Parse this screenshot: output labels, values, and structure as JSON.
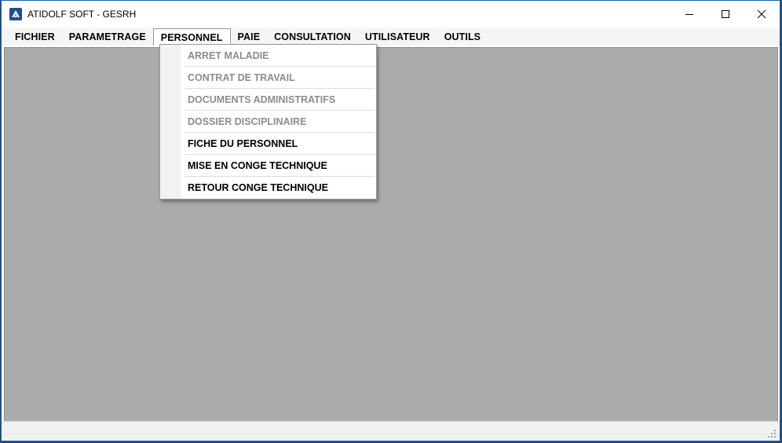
{
  "window": {
    "title": "ATIDOLF SOFT - GESRH",
    "controls": [
      "minimize-icon",
      "maximize-icon",
      "close-icon"
    ]
  },
  "menubar": {
    "items": [
      {
        "label": "FICHIER"
      },
      {
        "label": "PARAMETRAGE"
      },
      {
        "label": "PERSONNEL",
        "open": true
      },
      {
        "label": "PAIE"
      },
      {
        "label": "CONSULTATION"
      },
      {
        "label": "UTILISATEUR"
      },
      {
        "label": "OUTILS"
      }
    ]
  },
  "dropdown": {
    "items": [
      {
        "label": "ARRET MALADIE",
        "enabled": false
      },
      {
        "label": "CONTRAT DE TRAVAIL",
        "enabled": false
      },
      {
        "label": "DOCUMENTS ADMINISTRATIFS",
        "enabled": false
      },
      {
        "label": "DOSSIER DISCIPLINAIRE",
        "enabled": false
      },
      {
        "label": "FICHE DU PERSONNEL",
        "enabled": true
      },
      {
        "label": "MISE EN CONGE TECHNIQUE",
        "enabled": true
      },
      {
        "label": "RETOUR CONGE TECHNIQUE",
        "enabled": true
      }
    ]
  },
  "colors": {
    "client_background": "#ababab",
    "disabled_text": "#8c8c8c",
    "title_icon": "#1f4f8a"
  }
}
